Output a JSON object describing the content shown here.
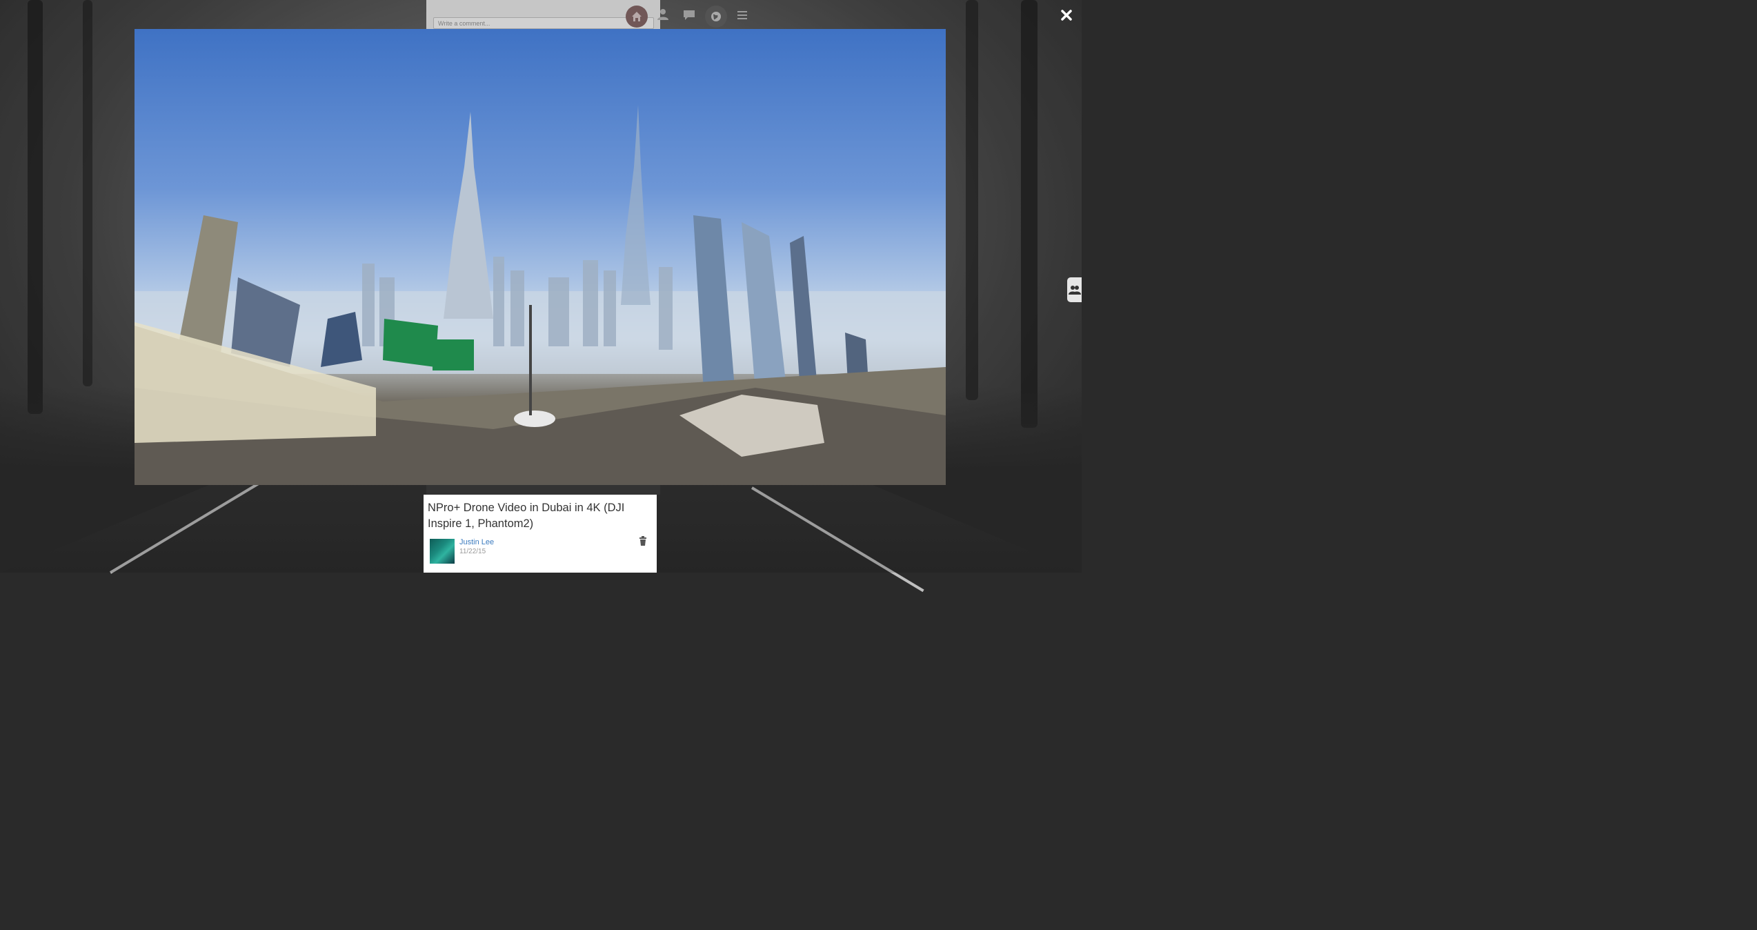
{
  "background": {
    "comment_placeholder": "Write a comment...",
    "nav_icons": [
      "home-icon",
      "user-icon",
      "chat-icon",
      "globe-icon",
      "menu-icon"
    ]
  },
  "viewer": {
    "close_icon": "close-icon",
    "media_description_icon": "video-frame"
  },
  "caption": {
    "title": "NPro+ Drone Video in Dubai in 4K (DJI Inspire 1, Phantom2)",
    "author": "Justin Lee",
    "date": "11/22/15",
    "delete_icon": "trash-icon"
  },
  "side_tab": {
    "icon": "users-icon"
  },
  "colors": {
    "link": "#3b7bbf",
    "sky_top": "#3f72c4",
    "overlay_close": "#ffffff"
  }
}
